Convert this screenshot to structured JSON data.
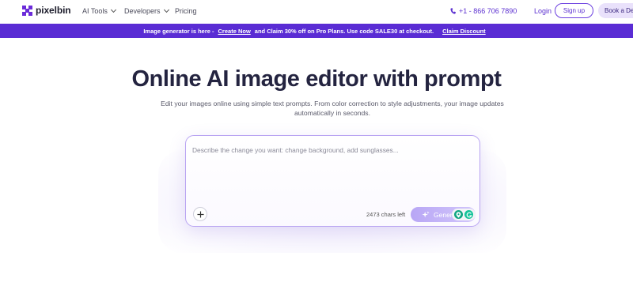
{
  "nav": {
    "logo_text": "pixelbin",
    "menu": [
      {
        "label": "AI Tools",
        "has_dropdown": true
      },
      {
        "label": "Developers",
        "has_dropdown": true
      },
      {
        "label": "Pricing",
        "has_dropdown": false
      }
    ],
    "phone": "+1 - 866 706 7890",
    "login_label": "Login",
    "signup_label": "Sign up",
    "demo_label": "Book a Demo"
  },
  "banner": {
    "lead": "Image generator is here -",
    "cta": "Create Now",
    "middle": "and Claim 30% off on Pro Plans. Use code SALE30 at checkout.",
    "claim": "Claim Discount"
  },
  "hero": {
    "title": "Online AI image editor with prompt",
    "subtitle": "Edit your images online using simple text prompts. From color correction to style adjustments, your image updates automatically in seconds."
  },
  "prompt": {
    "placeholder": "Describe the change you want: change background, add sunglasses...",
    "value": "",
    "chars_left": "2473 chars left",
    "generate_label": "Generate"
  },
  "colors": {
    "brand": "#5a2cd4",
    "accent_text": "#5b2fd0",
    "prompt_border": "#b9a4f2"
  },
  "icons": {
    "add": "plus-icon",
    "generate": "sparkle-icon",
    "phone": "phone-icon"
  }
}
